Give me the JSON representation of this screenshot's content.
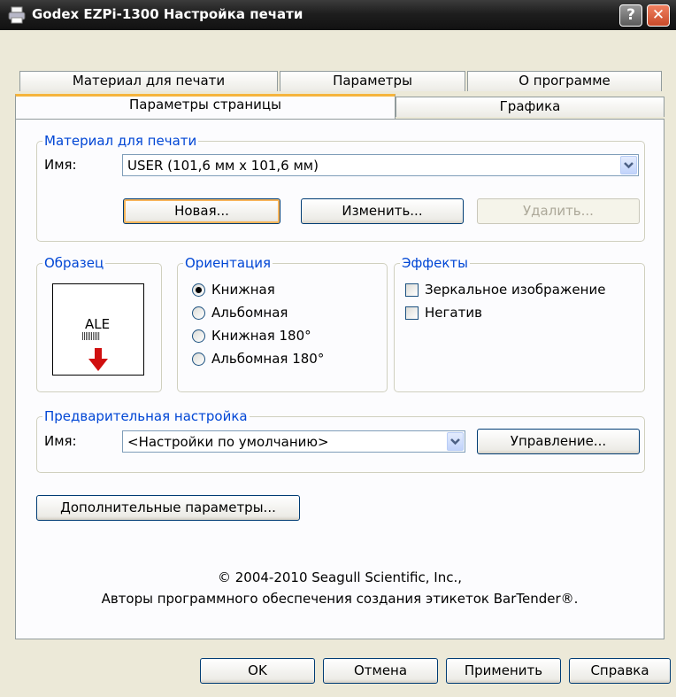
{
  "window": {
    "title": "Godex EZPi-1300 Настройка печати",
    "help": "?",
    "close": "✕"
  },
  "tabs": {
    "row_back": [
      "Материал для печати",
      "Параметры",
      "О программе"
    ],
    "row_front": [
      "Параметры страницы",
      "Графика"
    ]
  },
  "media": {
    "group": "Материал для печати",
    "name_label": "Имя:",
    "name_value": "USER (101,6 мм x 101,6 мм)",
    "new_button": "Новая...",
    "edit_button": "Изменить...",
    "delete_button": "Удалить..."
  },
  "sample": {
    "group": "Образец",
    "text": "ALE",
    "barcode": "||||||||||"
  },
  "orientation": {
    "group": "Ориентация",
    "options": [
      "Книжная",
      "Альбомная",
      "Книжная 180°",
      "Альбомная 180°"
    ],
    "selected_index": 0
  },
  "effects": {
    "group": "Эффекты",
    "options": [
      "Зеркальное изображение",
      "Негатив"
    ]
  },
  "preset": {
    "group": "Предварительная настройка",
    "name_label": "Имя:",
    "name_value": "<Настройки по умолчанию>",
    "manage_button": "Управление..."
  },
  "advanced_button": "Дополнительные параметры...",
  "copyright": {
    "line1": "© 2004-2010 Seagull Scientific, Inc.,",
    "line2": "Авторы программного обеспечения создания этикеток BarTender®."
  },
  "footer": {
    "ok": "OK",
    "cancel": "Отмена",
    "apply": "Применить",
    "help": "Справка"
  },
  "colors": {
    "accent_tab": "#f5b43c",
    "group_title": "#0046d5",
    "arrow": "#d01010"
  }
}
